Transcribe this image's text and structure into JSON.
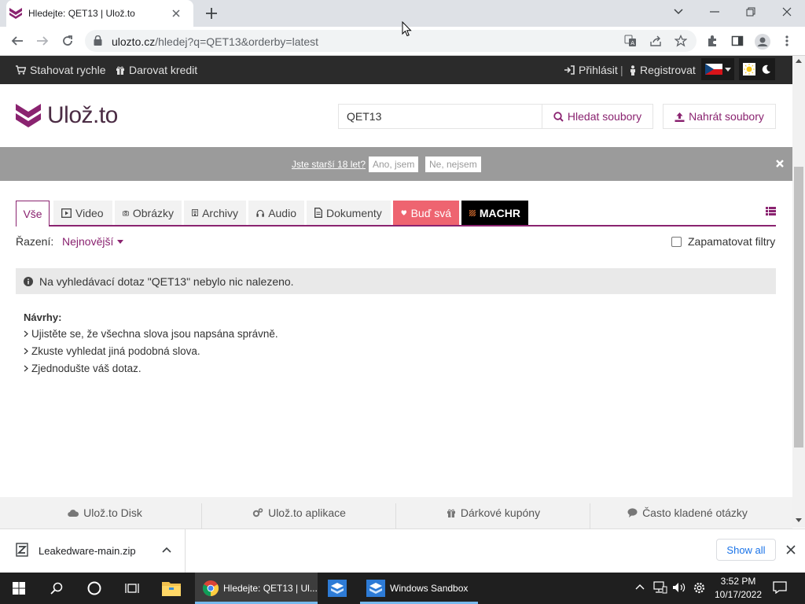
{
  "browser": {
    "tab_title": "Hledejte: QET13 | Ulož.to",
    "url_main": "ulozto.cz",
    "url_rest": "/hledej?q=QET13&orderby=latest"
  },
  "topbar": {
    "fast_download": "Stahovat rychle",
    "donate": "Darovat kredit",
    "login": "Přihlásit",
    "separator": "|",
    "register": "Registrovat"
  },
  "header": {
    "logo_text": "Ulož.to",
    "search_value": "QET13",
    "search_button": "Hledat soubory",
    "upload_button": "Nahrát soubory"
  },
  "age_banner": {
    "question": "Jste starší 18 let?",
    "yes": "Ano, jsem",
    "no": "Ne, nejsem"
  },
  "tabs": [
    {
      "label": "Vše"
    },
    {
      "label": "Video"
    },
    {
      "label": "Obrázky"
    },
    {
      "label": "Archivy"
    },
    {
      "label": "Audio"
    },
    {
      "label": "Dokumenty"
    },
    {
      "label": "Buď svá"
    },
    {
      "label": "MACHR"
    }
  ],
  "sort": {
    "label": "Řazení:",
    "value": "Nejnovější",
    "remember": "Zapamatovat filtry"
  },
  "alert": {
    "text": "Na vyhledávací dotaz \"QET13\" nebylo nic nalezeno."
  },
  "suggestions": {
    "title": "Návrhy:",
    "items": [
      "Ujistěte se, že všechna slova jsou napsána správně.",
      "Zkuste vyhledat jiná podobná slova.",
      "Zjednodušte váš dotaz."
    ]
  },
  "footer": {
    "items": [
      "Ulož.to Disk",
      "Ulož.to aplikace",
      "Dárkové kupóny",
      "Často kladené otázky"
    ]
  },
  "download_bar": {
    "file_name": "Leakedware-main.zip",
    "show_all": "Show all"
  },
  "taskbar": {
    "chrome_label": "Hledejte: QET13 | Ul...",
    "sandbox_label": "Windows Sandbox",
    "time": "3:52 PM",
    "date": "10/17/2022"
  },
  "colors": {
    "brand": "#8a2370",
    "topbar": "#2b2b2b",
    "banner": "#9b9b9b",
    "bud_sva": "#ee6470"
  }
}
